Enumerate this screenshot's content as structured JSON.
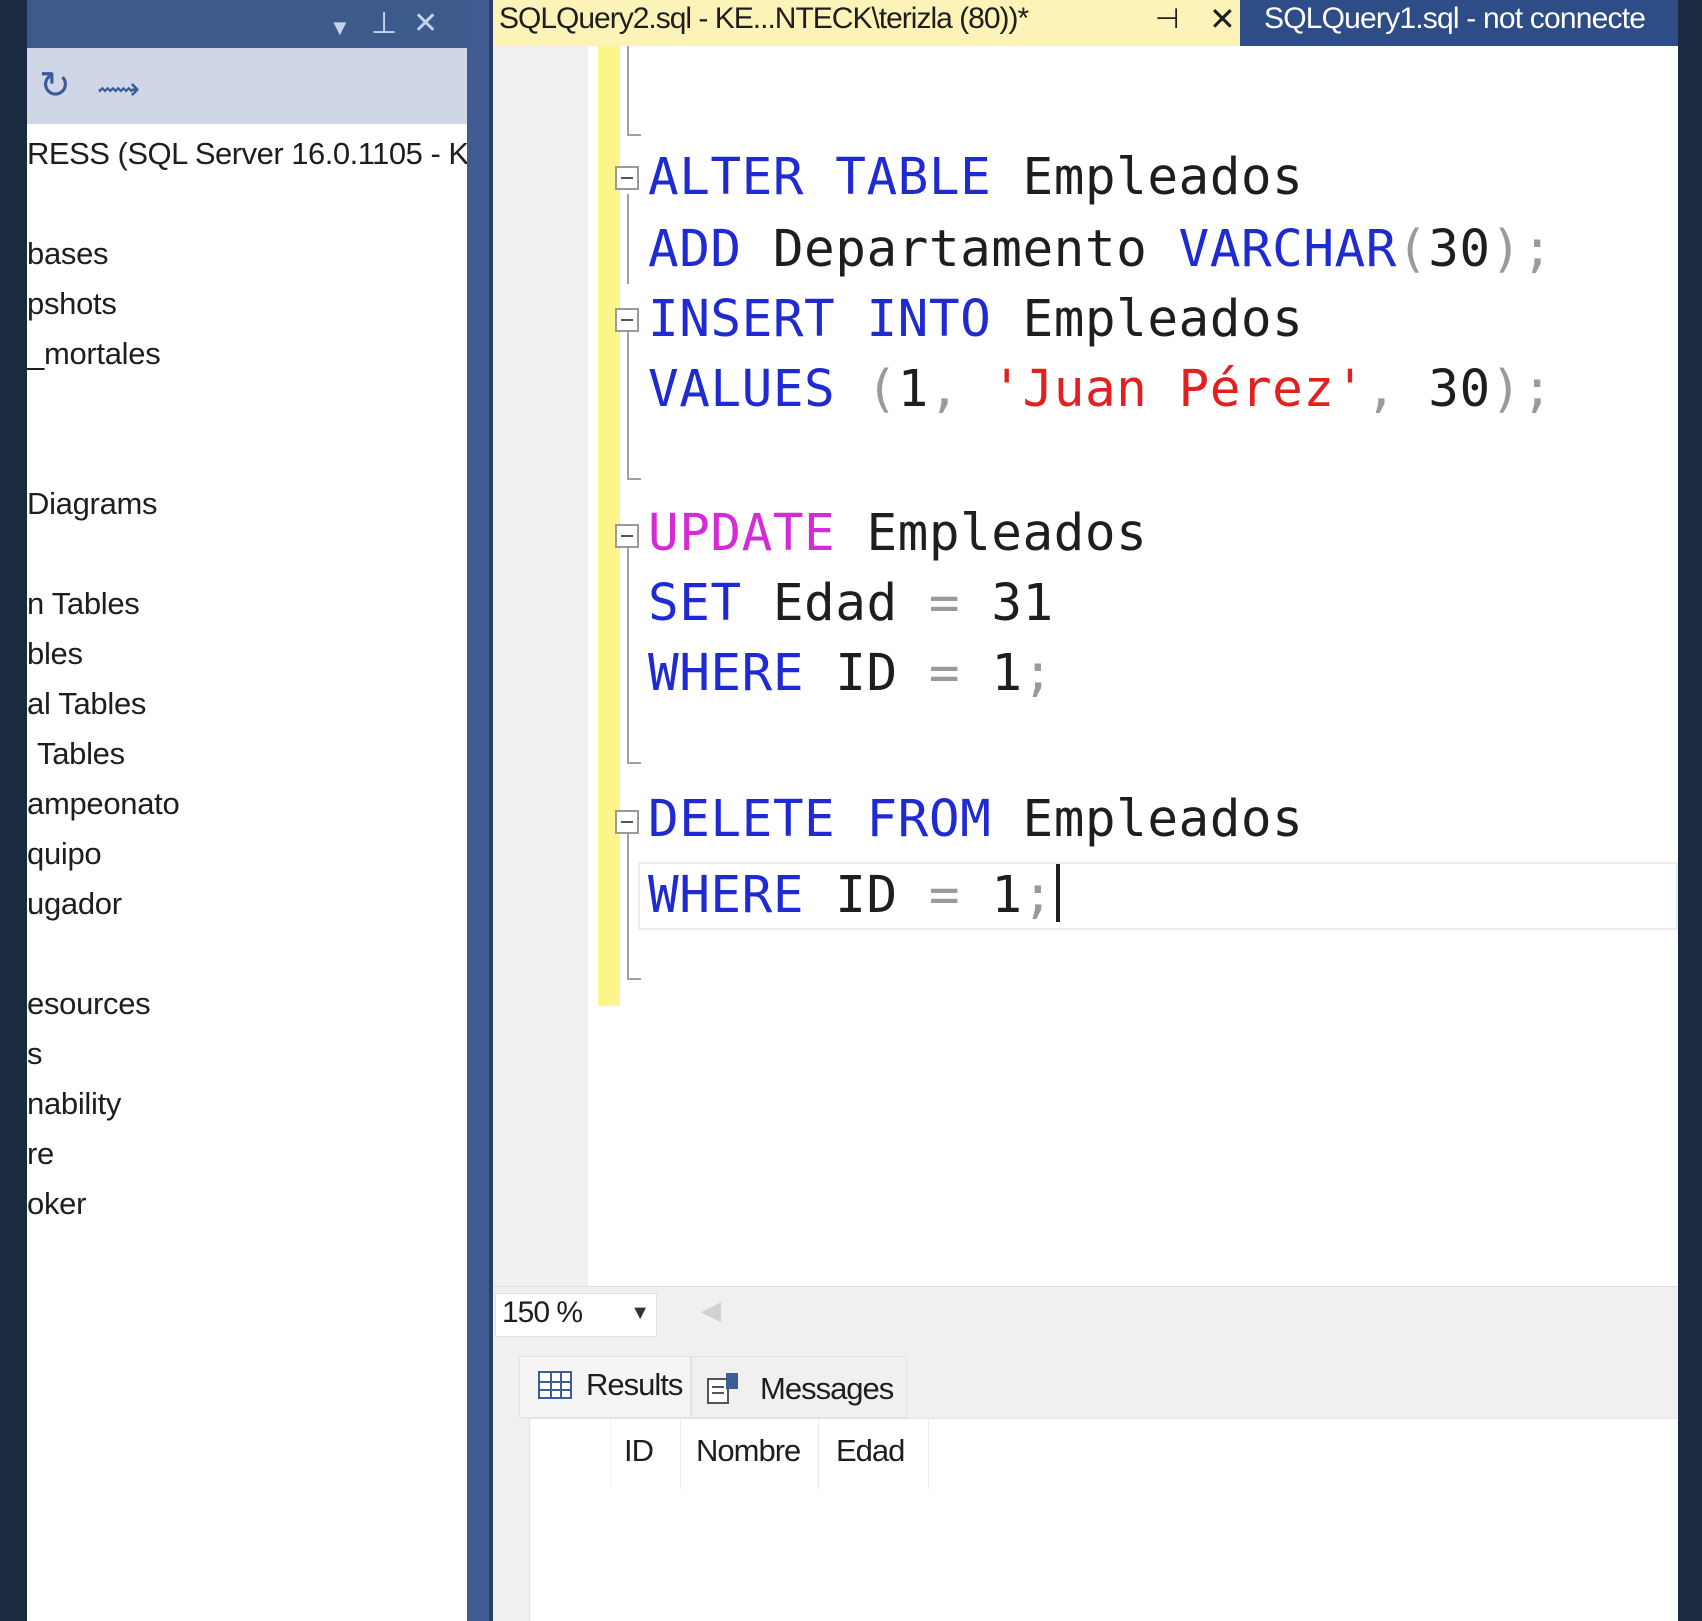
{
  "object_explorer": {
    "server": "RESS (SQL Server 16.0.1105 - K",
    "items": [
      "bases",
      "pshots",
      "_mortales",
      "Diagrams",
      "n Tables",
      "bles",
      "al Tables",
      "Tables",
      "ampeonato",
      "quipo",
      "ugador",
      "esources",
      "s",
      "nability",
      "re",
      "oker"
    ]
  },
  "tabs": {
    "active": "SQLQuery2.sql - KE...NTECK\\terizla (80))*",
    "inactive": "SQLQuery1.sql - not connecte"
  },
  "editor": {
    "lines": [
      {
        "kw1": "ALTER",
        "kw2": "TABLE",
        "ident": "Empleados"
      },
      {
        "kw1": "ADD",
        "ident": "Departamento",
        "type": "VARCHAR",
        "open": "(",
        "num": "30",
        "close": ")",
        "semi": ";"
      },
      {
        "kw1": "INSERT",
        "kw2": "INTO",
        "ident": "Empleados"
      },
      {
        "kw1": "VALUES",
        "open": "(",
        "num1": "1",
        "comma1": ",",
        "str": "'Juan Pérez'",
        "comma2": ",",
        "num2": "30",
        "close": ")",
        "semi": ";"
      },
      {
        "kw1": "UPDATE",
        "ident": "Empleados"
      },
      {
        "kw1": "SET",
        "ident": "Edad",
        "op": "=",
        "num": "31"
      },
      {
        "kw1": "WHERE",
        "ident": "ID",
        "op": "=",
        "num": "1",
        "semi": ";"
      },
      {
        "kw1": "DELETE",
        "kw2": "FROM",
        "ident": "Empleados"
      },
      {
        "kw1": "WHERE",
        "ident": "ID",
        "op": "=",
        "num": "1",
        "semi": ";"
      }
    ]
  },
  "zoom": {
    "value": "150 %"
  },
  "results": {
    "tab_results": "Results",
    "tab_messages": "Messages",
    "columns": [
      "ID",
      "Nombre",
      "Edad"
    ]
  },
  "colors": {
    "keyword": "#1f2bd1",
    "update_keyword": "#d52bd6",
    "string": "#e2201f",
    "active_tab": "#fbf3b7",
    "inactive_tab": "#2e4c86"
  }
}
